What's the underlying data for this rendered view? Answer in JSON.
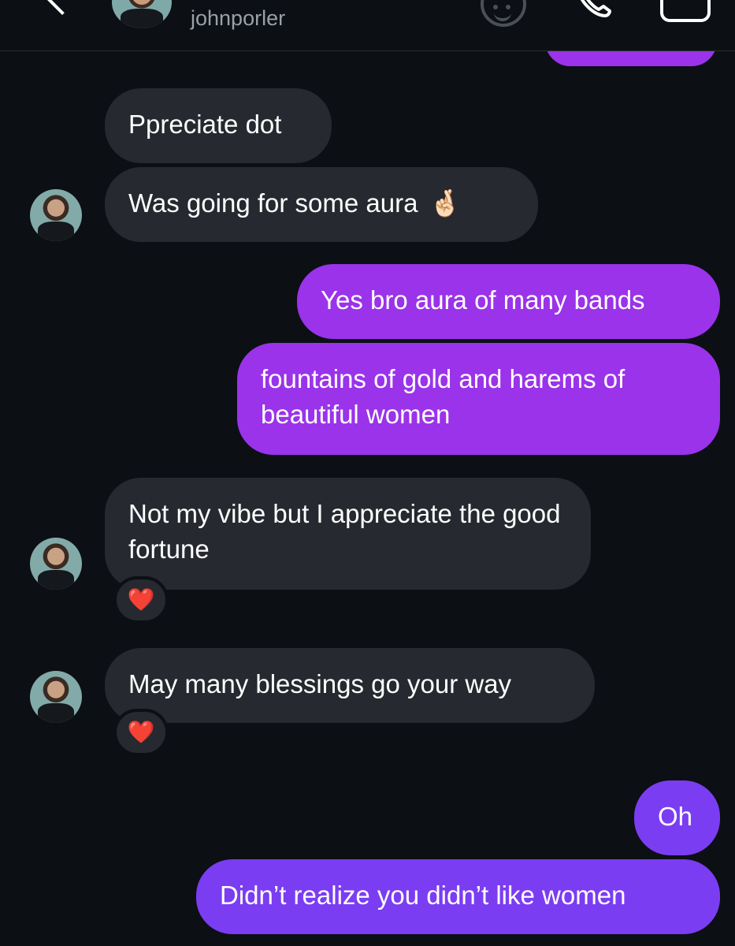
{
  "header": {
    "username": "johnporler",
    "icons": {
      "back": "chevron-left-icon",
      "avatar": "profile-avatar",
      "emoji": "smiley-sticker-icon",
      "call": "phone-icon",
      "video": "video-camera-icon"
    }
  },
  "messages": [
    {
      "direction": "out",
      "text": ""
    },
    {
      "direction": "in",
      "text": "Ppreciate dot"
    },
    {
      "direction": "in",
      "text": "Was going for some aura",
      "emoji": "🤞🏻"
    },
    {
      "direction": "out",
      "text": "Yes bro aura of many bands"
    },
    {
      "direction": "out",
      "text": "fountains of gold and harems of beautiful women"
    },
    {
      "direction": "in",
      "text": "Not my vibe but I appreciate the good fortune",
      "reaction": "❤️"
    },
    {
      "direction": "in",
      "text": "May many blessings go your way",
      "reaction": "❤️"
    },
    {
      "direction": "out",
      "text": "Oh"
    },
    {
      "direction": "out",
      "text": "Didn’t realize you didn’t like women"
    }
  ],
  "colors": {
    "background": "#0c0f14",
    "incoming_bubble": "#26292f",
    "outgoing_bubble": "#9a33ea",
    "outgoing_bubble_late": "#7b3df2",
    "username_text": "#9aa0a8"
  }
}
